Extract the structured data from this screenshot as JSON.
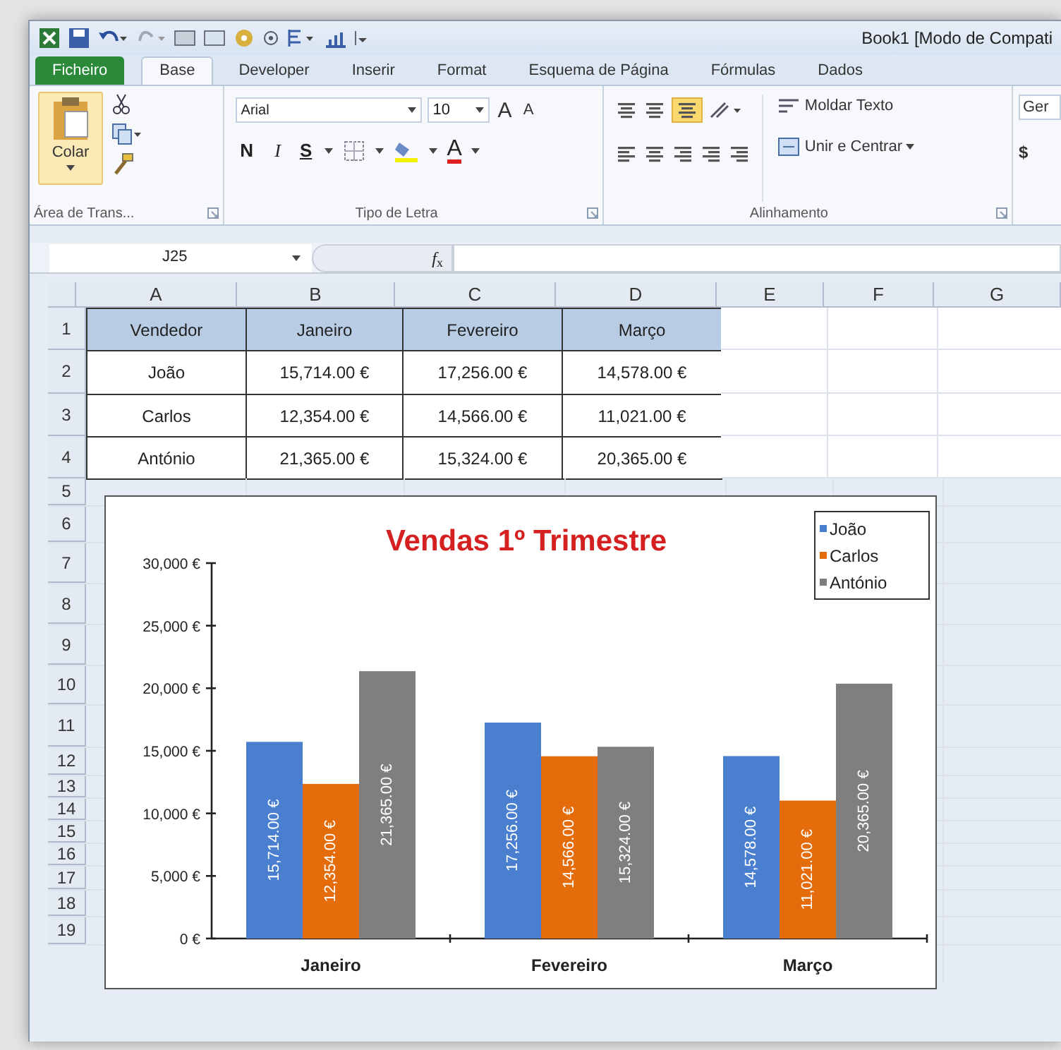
{
  "window": {
    "title": "Book1  [Modo de Compati"
  },
  "ribbon_tabs": [
    {
      "label": "Ficheiro",
      "kind": "file",
      "selected": false
    },
    {
      "label": "Base",
      "kind": "tab",
      "selected": true
    },
    {
      "label": "Developer",
      "kind": "tab",
      "selected": false
    },
    {
      "label": "Inserir",
      "kind": "tab",
      "selected": false
    },
    {
      "label": "Format",
      "kind": "tab",
      "selected": false
    },
    {
      "label": "Esquema de Página",
      "kind": "tab",
      "selected": false
    },
    {
      "label": "Fórmulas",
      "kind": "tab",
      "selected": false
    },
    {
      "label": "Dados",
      "kind": "tab",
      "selected": false
    }
  ],
  "ribbon": {
    "clipboard": {
      "paste": "Colar",
      "group_label": "Área de Trans..."
    },
    "font": {
      "font_name": "Arial",
      "font_size": "10",
      "grow": "A",
      "shrink": "A",
      "bold": "N",
      "italic": "I",
      "underline": "S",
      "color_letter": "A",
      "group_label": "Tipo de Letra"
    },
    "alignment": {
      "wrap_text": "Moldar Texto",
      "merge_center": "Unir e Centrar",
      "group_label": "Alinhamento"
    },
    "number": {
      "format": "Ger",
      "currency": "$"
    }
  },
  "formula_bar": {
    "name_box": "J25",
    "function_label": "*f*$_{x}$"
  },
  "sheet": {
    "columns": [
      "A",
      "B",
      "C",
      "D",
      "E",
      "F",
      "G"
    ],
    "row_numbers": [
      "1",
      "2",
      "3",
      "4",
      "5",
      "6",
      "7",
      "8",
      "9",
      "10",
      "11",
      "12",
      "13",
      "14",
      "15",
      "16",
      "17",
      "18",
      "19"
    ],
    "table": [
      [
        "Vendedor",
        "Janeiro",
        "Fevereiro",
        "Março"
      ],
      [
        "João",
        "15,714.00 €",
        "17,256.00 €",
        "14,578.00 €"
      ],
      [
        "Carlos",
        "12,354.00 €",
        "14,566.00 €",
        "11,021.00 €"
      ],
      [
        "António",
        "21,365.00 €",
        "15,324.00 €",
        "20,365.00 €"
      ]
    ]
  },
  "chart": {
    "chart_data": {
      "type": "bar",
      "title": "Vendas 1º Trimestre",
      "categories": [
        "Janeiro",
        "Fevereiro",
        "Março"
      ],
      "series": [
        {
          "name": "João",
          "color": "#4a7fd0",
          "values": [
            15714,
            17256,
            14578
          ]
        },
        {
          "name": "Carlos",
          "color": "#e46c0a",
          "values": [
            12354,
            14566,
            11021
          ]
        },
        {
          "name": "António",
          "color": "#7f7f7f",
          "values": [
            21365,
            15324,
            20365
          ]
        }
      ],
      "ylim": [
        0,
        30000
      ],
      "legend": "upper right",
      "yticks": [
        {
          "value": 0,
          "label": "0 €"
        },
        {
          "value": 5000,
          "label": "5,000 €"
        },
        {
          "value": 10000,
          "label": "10,000 €"
        },
        {
          "value": 15000,
          "label": "15,000 €"
        },
        {
          "value": 20000,
          "label": "20,000 €"
        },
        {
          "value": 25000,
          "label": "25,000 €"
        },
        {
          "value": 30000,
          "label": "30,000 €"
        }
      ],
      "value_labels": [
        [
          "15,714.00 €",
          "17,256.00 €",
          "14,578.00 €"
        ],
        [
          "12,354.00 €",
          "14,566.00 €",
          "11,021.00 €"
        ],
        [
          "21,365.00 €",
          "15,324.00 €",
          "20,365.00 €"
        ]
      ]
    }
  }
}
